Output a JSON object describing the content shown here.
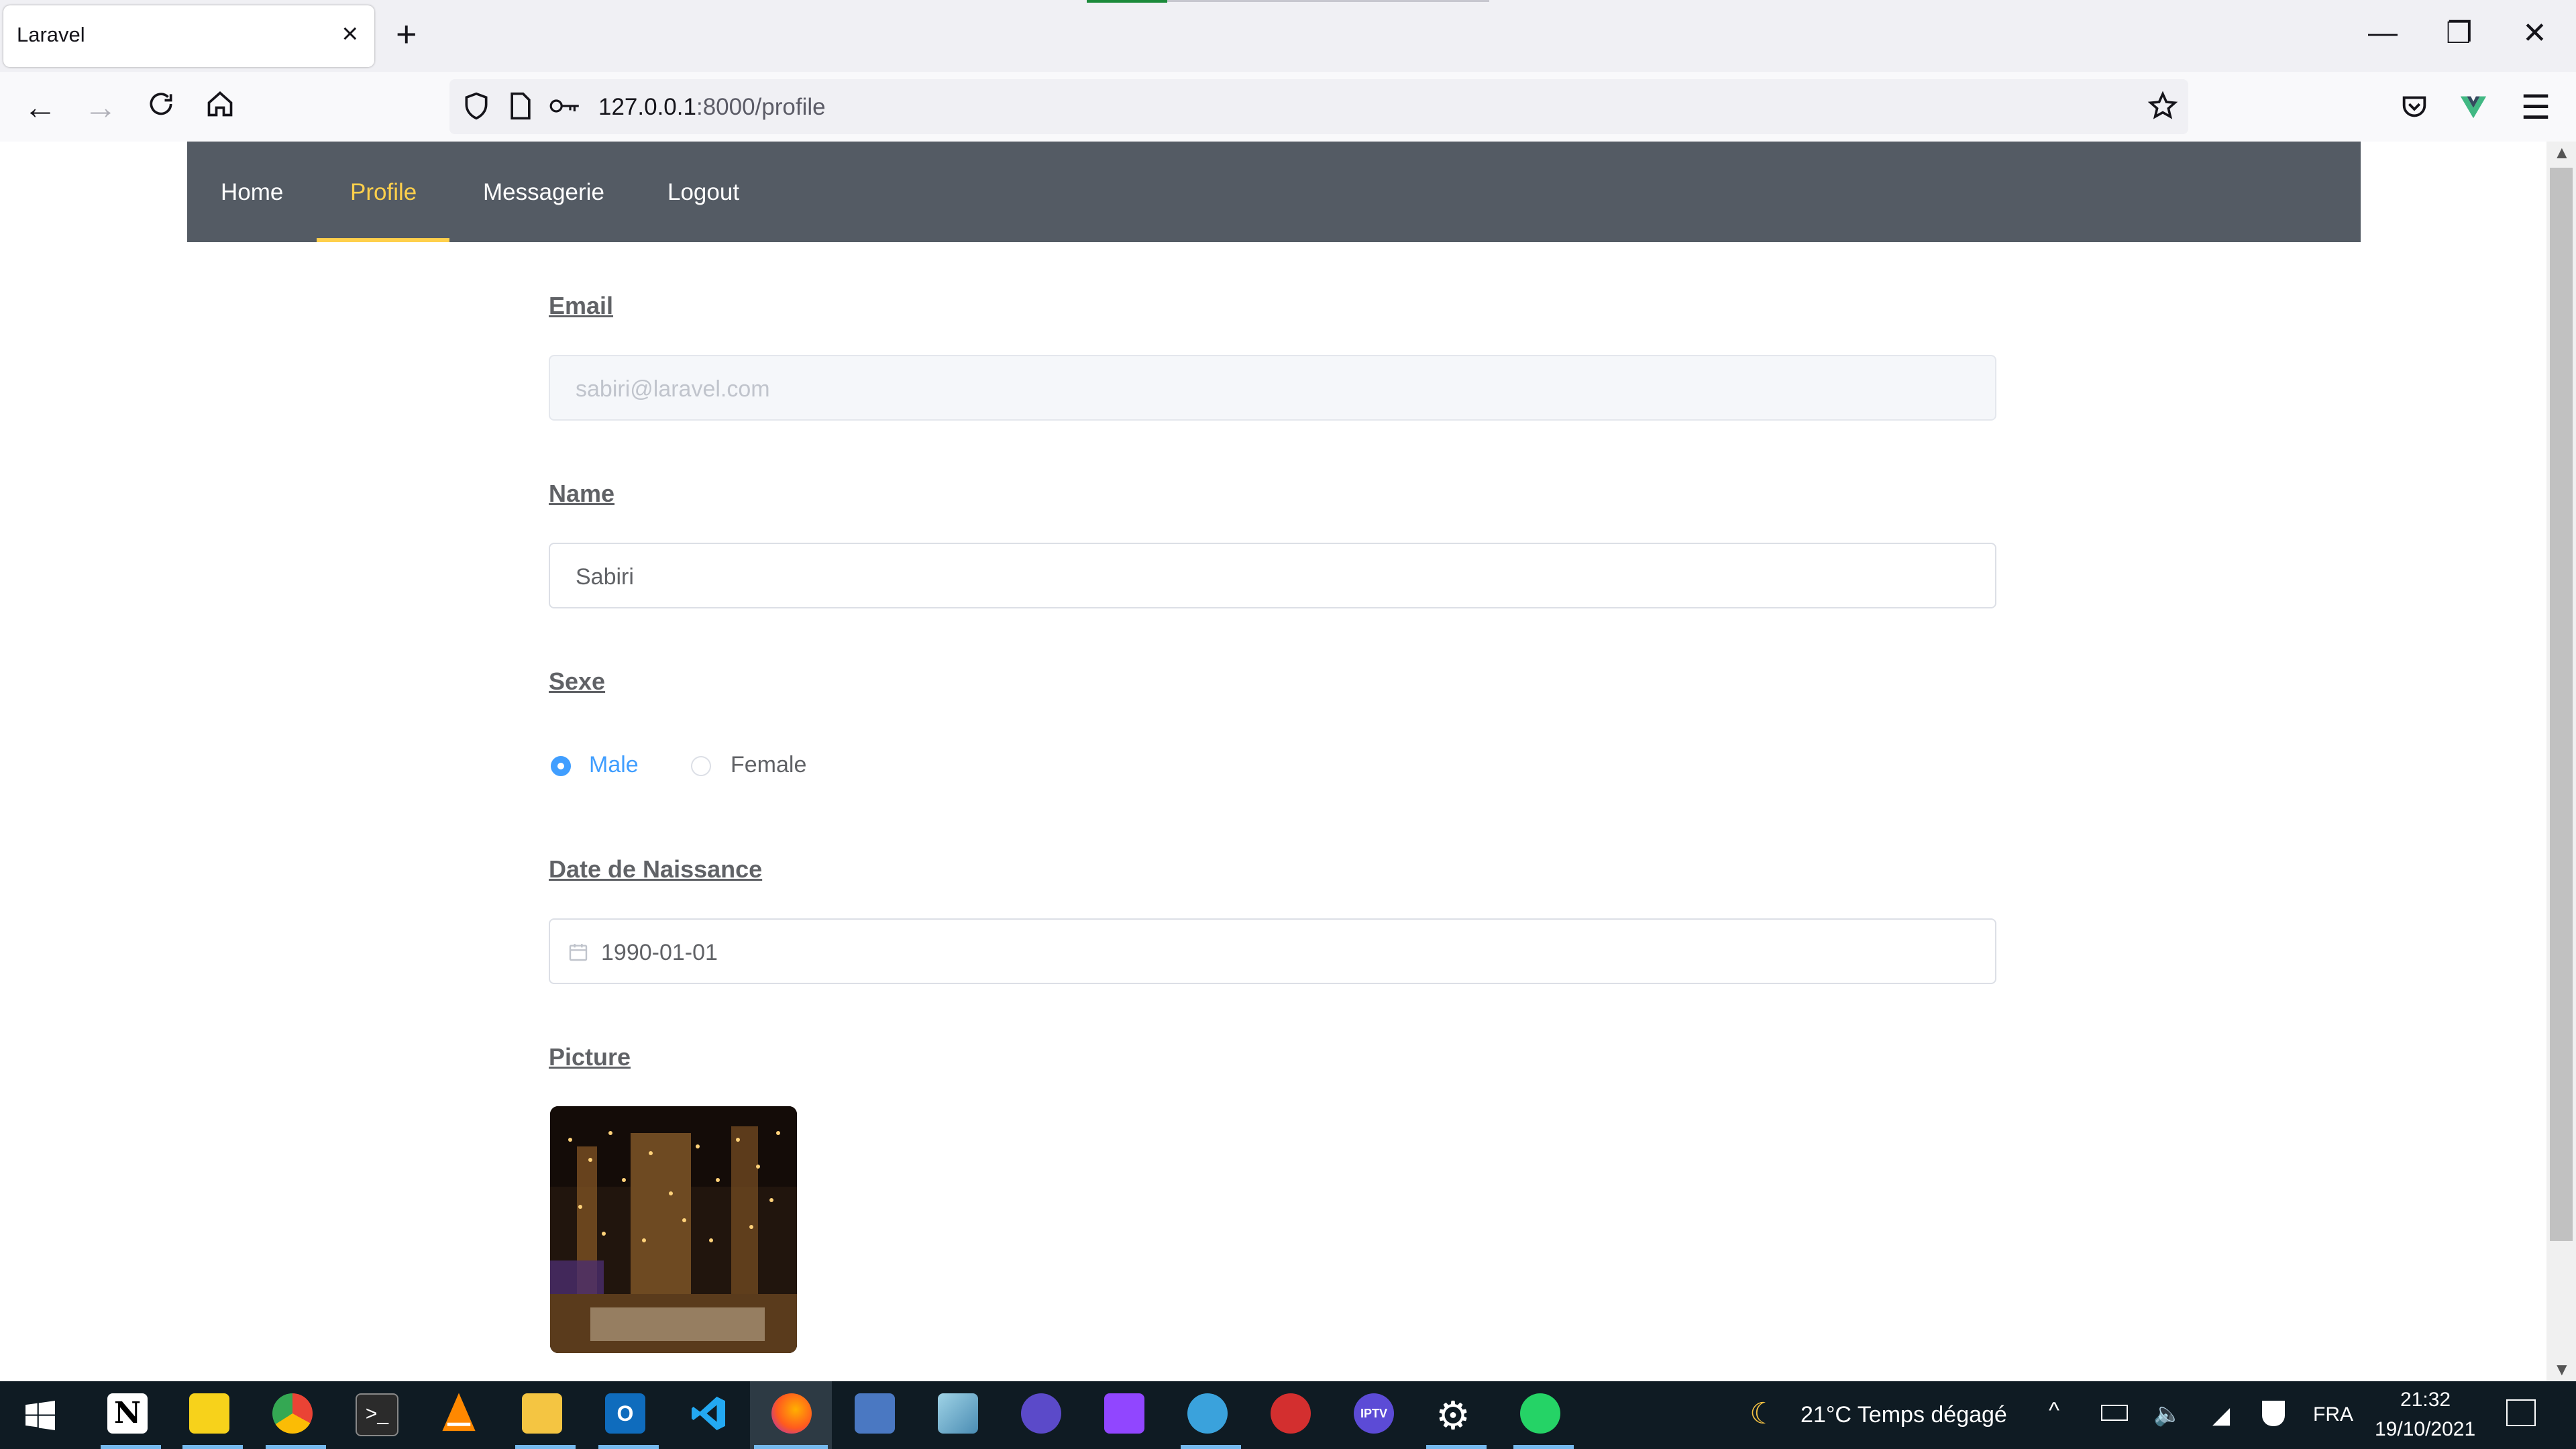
{
  "browser": {
    "tab_title": "Laravel",
    "tab_close": "×",
    "new_tab": "+",
    "url_host": "127.0.0.1",
    "url_path": ":8000/profile",
    "window_controls": {
      "minimize": "—",
      "restore": "❐",
      "close": "✕"
    }
  },
  "site_nav": {
    "items": [
      {
        "label": "Home"
      },
      {
        "label": "Profile"
      },
      {
        "label": "Messagerie"
      },
      {
        "label": "Logout"
      }
    ],
    "active": "Profile"
  },
  "form": {
    "email_label": "Email",
    "email_value": "sabiri@laravel.com",
    "name_label": "Name",
    "name_value": "Sabiri",
    "sexe_label": "Sexe",
    "sexe_options": [
      {
        "label": "Male",
        "selected": true
      },
      {
        "label": "Female",
        "selected": false
      }
    ],
    "dob_label": "Date de Naissance",
    "dob_value": "1990-01-01",
    "picture_label": "Picture"
  },
  "taskbar": {
    "weather": "21°C  Temps dégagé",
    "language": "FRA",
    "time": "21:32",
    "date": "19/10/2021"
  },
  "colors": {
    "nav_bg": "#545b64",
    "nav_active": "#ffd04b",
    "radio_active": "#409eff",
    "label_text": "#606266"
  }
}
